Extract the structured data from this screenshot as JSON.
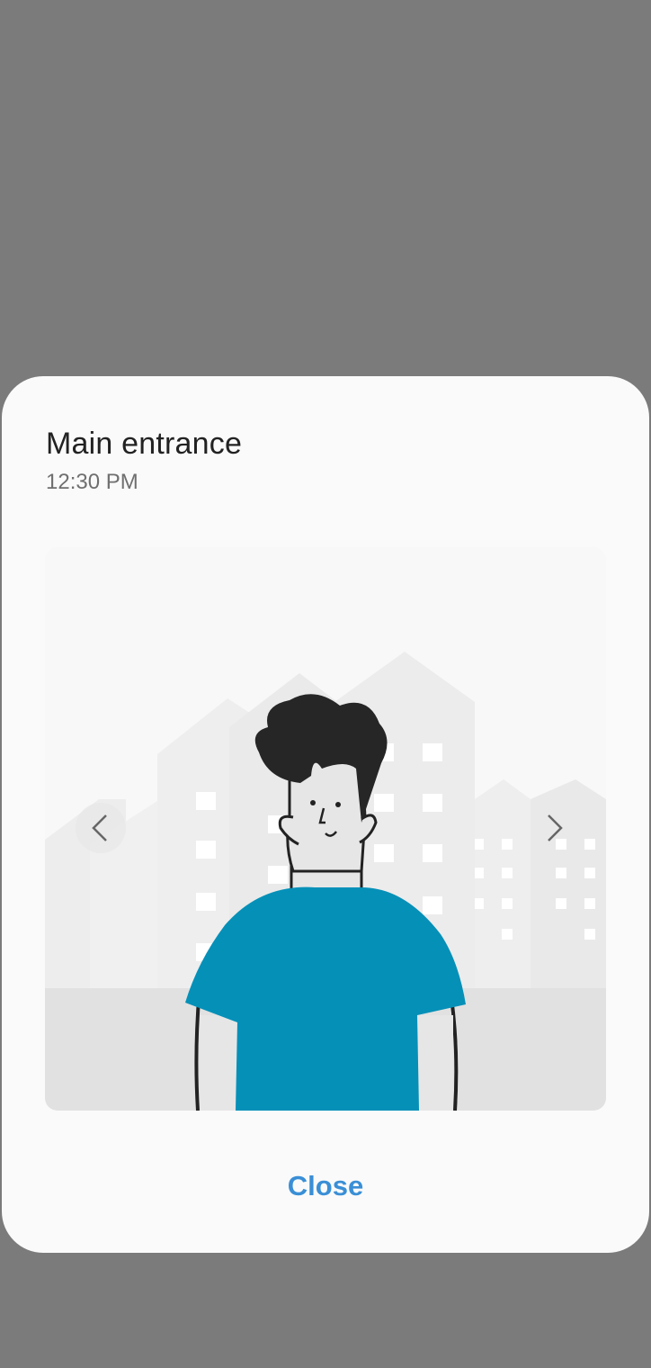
{
  "dialog": {
    "title": "Main entrance",
    "time": "12:30 PM",
    "close_label": "Close"
  },
  "media": {
    "image": "person-illustration",
    "prev_icon": "chevron-left-icon",
    "next_icon": "chevron-right-icon"
  },
  "colors": {
    "scrim": "#7b7b7b",
    "dialog_bg": "#fafafa",
    "accent": "#3a8fd6",
    "shirt": "#0590b8"
  }
}
